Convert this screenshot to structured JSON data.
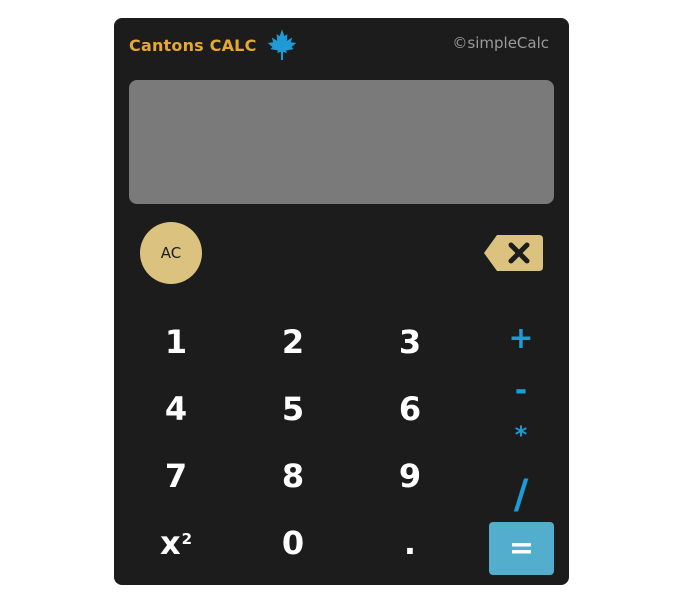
{
  "header": {
    "title": "Cantons CALC",
    "copyright": "©simpleCalc"
  },
  "display": {
    "value": ""
  },
  "controls": {
    "clear_label": "AC"
  },
  "keypad": {
    "k1": "1",
    "k2": "2",
    "k3": "3",
    "k4": "4",
    "k5": "5",
    "k6": "6",
    "k7": "7",
    "k8": "8",
    "k9": "9",
    "k0": "0",
    "square_base": "x",
    "square_exp": "2",
    "decimal": "."
  },
  "operators": {
    "add": "+",
    "subtract": "-",
    "multiply": "*",
    "divide": "/",
    "equals": "="
  },
  "icons": {
    "brand": "maple-leaf-icon",
    "backspace": "backspace-icon"
  },
  "colors": {
    "body": "#1c1c1c",
    "brand": "#e7a831",
    "leaf": "#1e9ad6",
    "display": "#7a7a7a",
    "clear": "#dcc27f",
    "operator": "#1e9ad6",
    "equals": "#53aecd"
  }
}
